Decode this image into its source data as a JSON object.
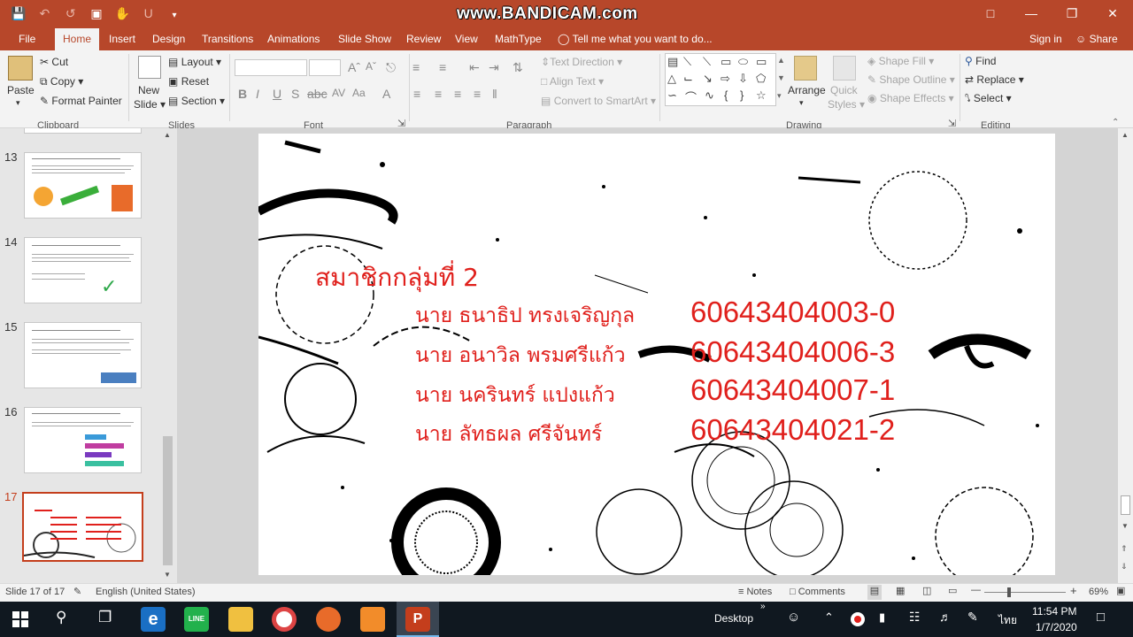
{
  "titlebar": {
    "watermark": "www.BANDICAM.com",
    "sign_in": "Sign in",
    "share": "Share"
  },
  "tabs": [
    "File",
    "Home",
    "Insert",
    "Design",
    "Transitions",
    "Animations",
    "Slide Show",
    "Review",
    "View",
    "MathType"
  ],
  "tell_me": "Tell me what you want to do...",
  "clipboard": {
    "paste": "Paste",
    "cut": "Cut",
    "copy": "Copy",
    "format_painter": "Format Painter",
    "group": "Clipboard"
  },
  "slides_grp": {
    "new_slide_1": "New",
    "new_slide_2": "Slide",
    "layout": "Layout",
    "reset": "Reset",
    "section": "Section",
    "group": "Slides"
  },
  "font_grp": {
    "group": "Font"
  },
  "paragraph": {
    "text_direction": "Text Direction",
    "align_text": "Align Text",
    "convert": "Convert to SmartArt",
    "group": "Paragraph"
  },
  "drawing": {
    "arrange": "Arrange",
    "quick_styles_1": "Quick",
    "quick_styles_2": "Styles",
    "shape_fill": "Shape Fill",
    "shape_outline": "Shape Outline",
    "shape_effects": "Shape Effects",
    "group": "Drawing"
  },
  "editing": {
    "find": "Find",
    "replace": "Replace",
    "select": "Select",
    "group": "Editing"
  },
  "thumbnails": [
    {
      "num": "13"
    },
    {
      "num": "14"
    },
    {
      "num": "15"
    },
    {
      "num": "16"
    },
    {
      "num": "17"
    }
  ],
  "slide": {
    "heading": "สมาชิกกลุ่มที่ 2",
    "members": [
      {
        "name": "นาย ธนาธิป  ทรงเจริญกุล",
        "id": "60643404003-0"
      },
      {
        "name": "นาย อนาวิล  พรมศรีแก้ว",
        "id": "60643404006-3"
      },
      {
        "name": "นาย นครินทร์  แปงแก้ว",
        "id": "60643404007-1"
      },
      {
        "name": "นาย ลัทธผล  ศรีจันทร์",
        "id": "60643404021-2"
      }
    ]
  },
  "status": {
    "slide_of": "Slide 17 of 17",
    "language": "English (United States)",
    "notes": "Notes",
    "comments": "Comments",
    "zoom": "69%"
  },
  "taskbar": {
    "desktop": "Desktop",
    "lang": "ไทย",
    "time": "11:54 PM",
    "date": "1/7/2020"
  },
  "colors": {
    "accent": "#b7472a",
    "slide_text": "#e0201c",
    "thumb_selected": "#c43e1c"
  }
}
